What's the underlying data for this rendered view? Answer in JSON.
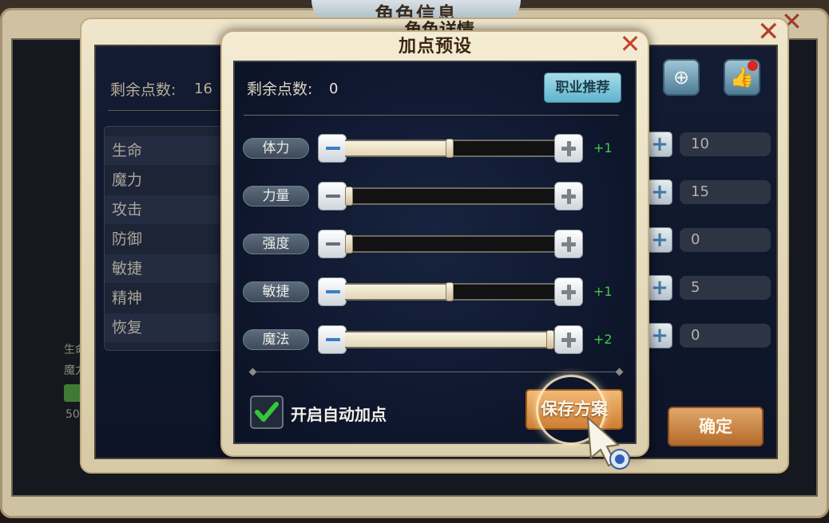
{
  "background": {
    "outer_title": "角色信息",
    "detail_title": "角色详情",
    "remaining_label": "剩余点数:",
    "remaining_value": "16",
    "stats": [
      "生命",
      "魔力",
      "攻击",
      "防御",
      "敏捷",
      "精神",
      "恢复"
    ],
    "right_values": [
      "10",
      "15",
      "0",
      "5",
      "0"
    ],
    "confirm_label": "确定",
    "mini_labels": {
      "life": "生命",
      "mana": "魔力",
      "level": "50"
    },
    "icons": [
      "target-icon",
      "thumbs-up-icon"
    ]
  },
  "modal": {
    "title": "加点预设",
    "remaining_label": "剩余点数:",
    "remaining_value": "0",
    "career_button": "职业推荐",
    "attributes": [
      {
        "name": "体力",
        "level": 0.5,
        "delta": "+1",
        "minus_enabled": true
      },
      {
        "name": "力量",
        "level": 0.0,
        "delta": "",
        "minus_enabled": false
      },
      {
        "name": "强度",
        "level": 0.0,
        "delta": "",
        "minus_enabled": false
      },
      {
        "name": "敏捷",
        "level": 0.5,
        "delta": "+1",
        "minus_enabled": true
      },
      {
        "name": "魔法",
        "level": 1.0,
        "delta": "+2",
        "minus_enabled": true
      }
    ],
    "auto_label": "开启自动加点",
    "auto_checked": true,
    "save_button": "保存方案"
  },
  "colors": {
    "accent_green": "#3fce3f",
    "button_orange": "#cd7f33",
    "button_teal": "#5fb4cd",
    "close_red": "#c2452f"
  }
}
